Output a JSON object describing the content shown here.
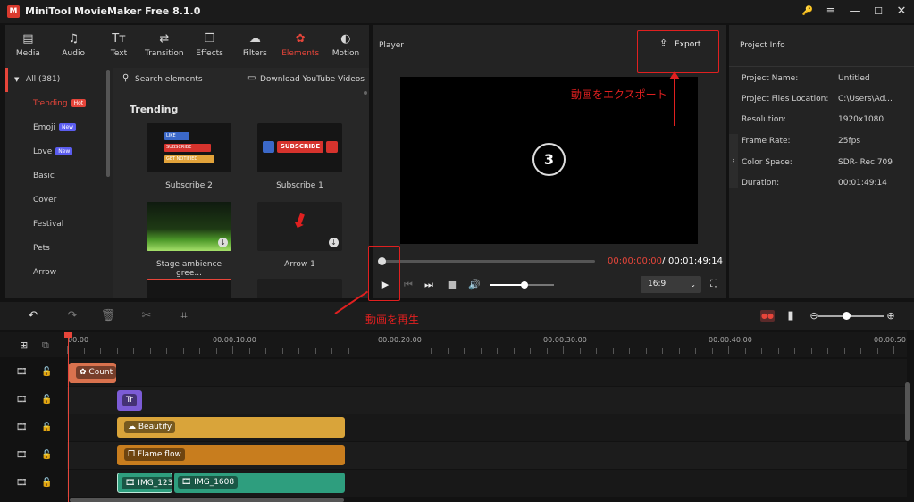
{
  "app": {
    "logo": "M",
    "title": "MiniTool MovieMaker Free 8.1.0",
    "window_icons": [
      "key-icon",
      "menu-icon",
      "minimize-icon",
      "maximize-icon",
      "close-icon"
    ],
    "window_glyphs": [
      "🔑",
      "≡",
      "—",
      "☐",
      "✕"
    ]
  },
  "toolbar": {
    "tabs": [
      {
        "label": "Media",
        "icon": "media-icon",
        "glyph": "▤",
        "active": false
      },
      {
        "label": "Audio",
        "icon": "audio-icon",
        "glyph": "♫",
        "active": false
      },
      {
        "label": "Text",
        "icon": "text-icon",
        "glyph": "Tт",
        "active": false
      },
      {
        "label": "Transition",
        "icon": "transition-icon",
        "glyph": "⇄",
        "active": false
      },
      {
        "label": "Effects",
        "icon": "effects-icon",
        "glyph": "❐",
        "active": false
      },
      {
        "label": "Filters",
        "icon": "filters-icon",
        "glyph": "☁",
        "active": false
      },
      {
        "label": "Elements",
        "icon": "elements-icon",
        "glyph": "✿",
        "active": true
      },
      {
        "label": "Motion",
        "icon": "motion-icon",
        "glyph": "◐",
        "active": false
      }
    ]
  },
  "categories": {
    "header": "All (381)",
    "items": [
      {
        "label": "Trending",
        "badge": "Hot",
        "active": true
      },
      {
        "label": "Emoji",
        "badge": "New",
        "active": false
      },
      {
        "label": "Love",
        "badge": "New",
        "active": false
      },
      {
        "label": "Basic",
        "badge": "",
        "active": false
      },
      {
        "label": "Cover",
        "badge": "",
        "active": false
      },
      {
        "label": "Festival",
        "badge": "",
        "active": false
      },
      {
        "label": "Pets",
        "badge": "",
        "active": false
      },
      {
        "label": "Arrow",
        "badge": "",
        "active": false
      }
    ]
  },
  "elements": {
    "search_placeholder": "Search elements",
    "download_youtube": "Download YouTube Videos",
    "section_title": "Trending",
    "tiles": [
      {
        "caption": "Subscribe 2",
        "subscribe_lines": [
          "LIKE",
          "SUBSCRIBE",
          "GET NOTIFIED"
        ]
      },
      {
        "caption": "Subscribe 1",
        "subscribe_text": "SUBSCRIBE"
      },
      {
        "caption": "Stage ambience gree..."
      },
      {
        "caption": "Arrow 1"
      }
    ]
  },
  "player": {
    "title": "Player",
    "export_label": "Export",
    "countdown": "3",
    "time_current": "00:00:00:00",
    "time_separator": "/",
    "time_total": "00:01:49:14",
    "progress": 0.0,
    "volume": 0.5,
    "aspect_ratio": "16:9"
  },
  "project_info": {
    "title": "Project Info",
    "rows": [
      {
        "label": "Project Name:",
        "value": "Untitled"
      },
      {
        "label": "Project Files Location:",
        "value": "C:\\Users\\Ad..."
      },
      {
        "label": "Resolution:",
        "value": "1920x1080"
      },
      {
        "label": "Frame Rate:",
        "value": "25fps"
      },
      {
        "label": "Color Space:",
        "value": "SDR- Rec.709"
      },
      {
        "label": "Duration:",
        "value": "00:01:49:14"
      }
    ]
  },
  "annotations": {
    "export_note": "動画をエクスポート",
    "play_note": "動画を再生",
    "color": "#e02020"
  },
  "timeline": {
    "ruler_labels": [
      "00:00",
      "00:00:10:00",
      "00:00:20:00",
      "00:00:30:00",
      "00:00:40:00",
      "00:00:50"
    ],
    "clips": [
      {
        "label": "Count",
        "color": "#d9724e"
      },
      {
        "label": "Tr",
        "color": "#7c5cd6"
      },
      {
        "label": "Beautify",
        "color": "#d9a43a"
      },
      {
        "label": "Flame flow",
        "color": "#c87d1e"
      },
      {
        "label": "IMG_123",
        "color": "#2e9e7e"
      },
      {
        "label": "IMG_1608",
        "color": "#2e9e7e"
      }
    ]
  },
  "colors": {
    "accent": "#e6453a",
    "panel": "#232323",
    "background": "#121212"
  }
}
